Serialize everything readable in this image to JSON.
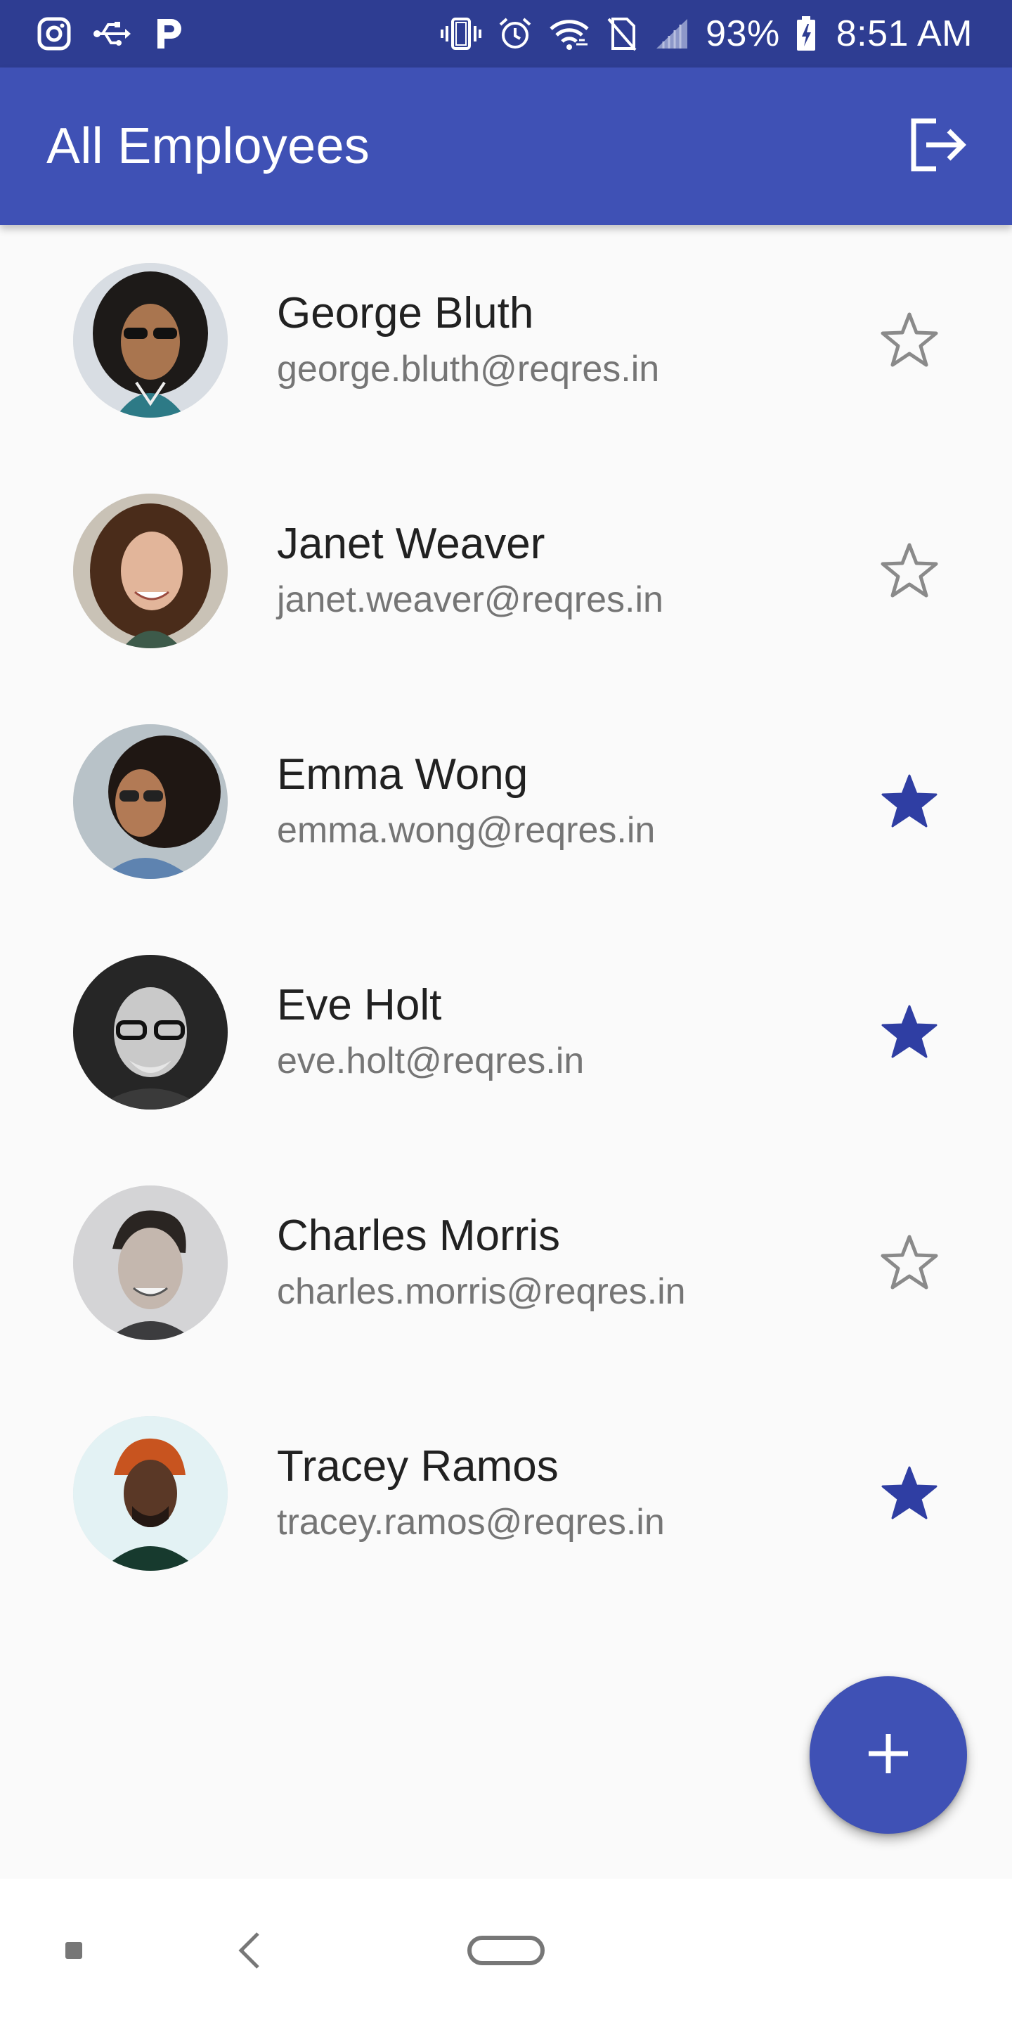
{
  "status_bar": {
    "left_icons": [
      "instagram-icon",
      "usb-icon",
      "pocket-p-icon"
    ],
    "right_icons": [
      "vibrate-icon",
      "alarm-icon",
      "wifi-icon",
      "no-sim-icon",
      "signal-icon",
      "battery-charging-icon"
    ],
    "battery": "93%",
    "time": "8:51 AM"
  },
  "app_bar": {
    "title": "All Employees",
    "logout_icon": "logout-icon"
  },
  "employees": [
    {
      "name": "George Bluth",
      "email": "george.bluth@reqres.in",
      "favorite": false
    },
    {
      "name": "Janet Weaver",
      "email": "janet.weaver@reqres.in",
      "favorite": false
    },
    {
      "name": "Emma Wong",
      "email": "emma.wong@reqres.in",
      "favorite": true
    },
    {
      "name": "Eve Holt",
      "email": "eve.holt@reqres.in",
      "favorite": true
    },
    {
      "name": "Charles Morris",
      "email": "charles.morris@reqres.in",
      "favorite": false
    },
    {
      "name": "Tracey Ramos",
      "email": "tracey.ramos@reqres.in",
      "favorite": true
    }
  ],
  "fab": {
    "icon": "add-icon"
  },
  "nav_bar": {
    "icons": [
      "recents-icon",
      "back-icon",
      "home-icon"
    ]
  },
  "colors": {
    "primary": "#3f51b5",
    "primary_dark": "#2e3d92",
    "star_filled": "#2f3ea3",
    "star_outline": "#8a8a8a"
  }
}
